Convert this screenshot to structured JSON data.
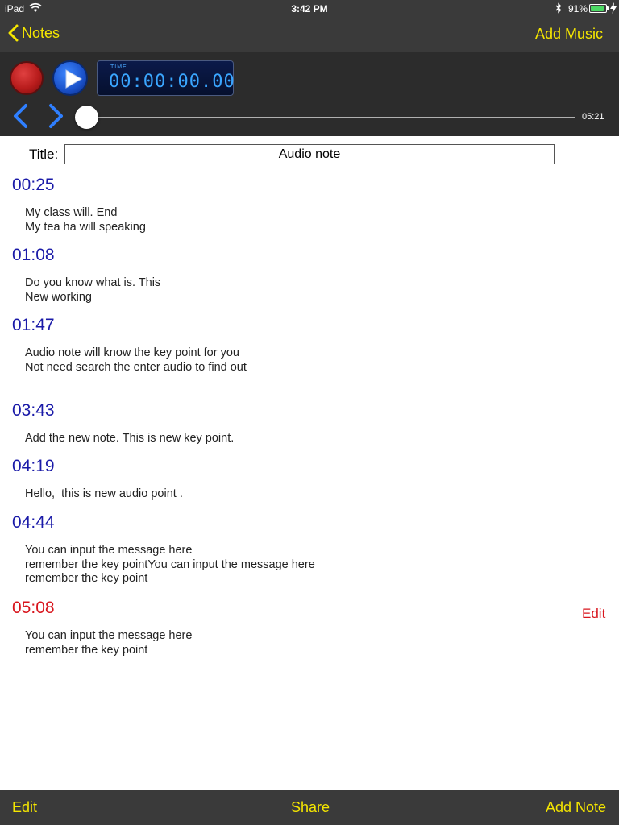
{
  "status_bar": {
    "device": "iPad",
    "time": "3:42 PM",
    "battery_percent": "91%",
    "battery_level": 0.91,
    "icons": [
      "wifi-icon",
      "bluetooth-icon",
      "battery-icon",
      "charging-bolt-icon"
    ]
  },
  "nav": {
    "back_label": "Notes",
    "right_label": "Add Music"
  },
  "player": {
    "timer_label": "TIME",
    "timer_value": "00:00:00.00",
    "duration": "05:21",
    "progress": 0,
    "icons": [
      "record-icon",
      "play-icon",
      "chevron-left-icon",
      "chevron-right-icon"
    ]
  },
  "title": {
    "label": "Title:",
    "value": "Audio note"
  },
  "notes": [
    {
      "time": "00:25",
      "lines": [
        "My class will. End",
        "My tea ha will speaking"
      ]
    },
    {
      "time": "01:08",
      "lines": [
        "Do you know what is. This",
        "New working"
      ]
    },
    {
      "time": "01:47",
      "lines": [
        "Audio note will know the key point for you",
        "Not need search the enter audio to find out"
      ]
    },
    {
      "time": "03:43",
      "lines": [
        "Add the new note. This is new key point."
      ]
    },
    {
      "time": "04:19",
      "lines": [
        "Hello,  this is new audio point ."
      ]
    },
    {
      "time": "04:44",
      "lines": [
        "You can input the message here",
        "remember the key pointYou can input the message here",
        "remember the key point"
      ]
    },
    {
      "time": "05:08",
      "lines": [
        "You can input the message here",
        "remember the key point"
      ],
      "selected": true
    }
  ],
  "note_edit_label": "Edit",
  "toolbar": {
    "edit_label": "Edit",
    "share_label": "Share",
    "add_note_label": "Add Note"
  },
  "colors": {
    "accent_yellow": "#f5e600",
    "bar_dark": "#3a3a3a",
    "timestamp_blue": "#1a1aa8",
    "selected_red": "#d8141c"
  }
}
